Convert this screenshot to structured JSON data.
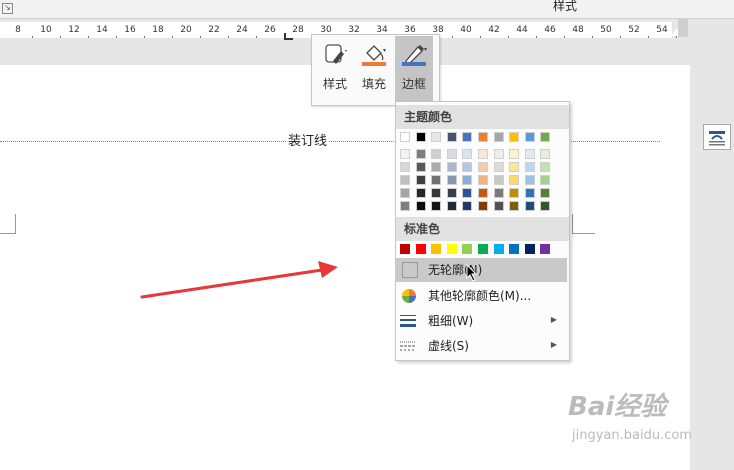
{
  "ribbon": {
    "group_label": "样式",
    "launcher_icon": "dialog-launcher-icon"
  },
  "ruler": {
    "labels": [
      "8",
      "10",
      "12",
      "14",
      "16",
      "18",
      "20",
      "22",
      "24",
      "26",
      "28",
      "30",
      "32",
      "34",
      "36",
      "38",
      "40",
      "42",
      "44",
      "46",
      "48",
      "50",
      "52",
      "54"
    ]
  },
  "document": {
    "binding_line_label": "装订线"
  },
  "mini_toolbar": {
    "buttons": [
      {
        "label": "样式",
        "icon": "shape-style-icon"
      },
      {
        "label": "填充",
        "icon": "fill-bucket-icon",
        "accent": "#ed7d31"
      },
      {
        "label": "边框",
        "icon": "pen-outline-icon",
        "accent": "#4472c4",
        "active": true
      }
    ]
  },
  "outline_menu": {
    "theme_colors_header": "主题颜色",
    "theme_colors_top": [
      "#ffffff",
      "#000000",
      "#e7e6e6",
      "#44546a",
      "#4472c4",
      "#ed7d31",
      "#a5a5a5",
      "#ffc000",
      "#5b9bd5",
      "#70ad47"
    ],
    "theme_colors_shades": [
      [
        "#f2f2f2",
        "#7f7f7f",
        "#d0cece",
        "#d6dce4",
        "#d9e2f3",
        "#fbe5d5",
        "#ededed",
        "#fff2cc",
        "#ddebf7",
        "#e2efd9"
      ],
      [
        "#d8d8d8",
        "#595959",
        "#aeaaaa",
        "#adb9ca",
        "#b4c6e7",
        "#f7cbac",
        "#dbdbdb",
        "#fee599",
        "#bdd7ee",
        "#c5e0b3"
      ],
      [
        "#bfbfbf",
        "#3f3f3f",
        "#757070",
        "#8496b0",
        "#8eaadb",
        "#f4b183",
        "#c9c9c9",
        "#ffd965",
        "#9cc3e5",
        "#a8d08d"
      ],
      [
        "#a5a5a5",
        "#262626",
        "#3a3838",
        "#323f4f",
        "#2f5496",
        "#c55a11",
        "#7b7b7b",
        "#bf8f00",
        "#2e75b5",
        "#538135"
      ],
      [
        "#7f7f7f",
        "#0c0c0c",
        "#171616",
        "#222a35",
        "#1f3864",
        "#843c0b",
        "#525252",
        "#7f6000",
        "#1e4e79",
        "#375623"
      ]
    ],
    "standard_colors_header": "标准色",
    "standard_colors": [
      "#c00000",
      "#ff0000",
      "#ffc000",
      "#ffff00",
      "#92d050",
      "#00b050",
      "#00b0f0",
      "#0070c0",
      "#002060",
      "#7030a0"
    ],
    "items": [
      {
        "label": "无轮廓(N)",
        "icon": "no-outline-icon",
        "highlighted": true
      },
      {
        "label": "其他轮廓颜色(M)...",
        "icon": "color-wheel-icon"
      },
      {
        "label": "粗细(W)",
        "icon": "line-weight-icon",
        "submenu": true
      },
      {
        "label": "虚线(S)",
        "icon": "dashes-icon",
        "submenu": true
      }
    ]
  },
  "annotation": {
    "arrow_color": "#e8373a"
  },
  "watermark": {
    "brand": "Bai经验",
    "url": "jingyan.baidu.com"
  }
}
